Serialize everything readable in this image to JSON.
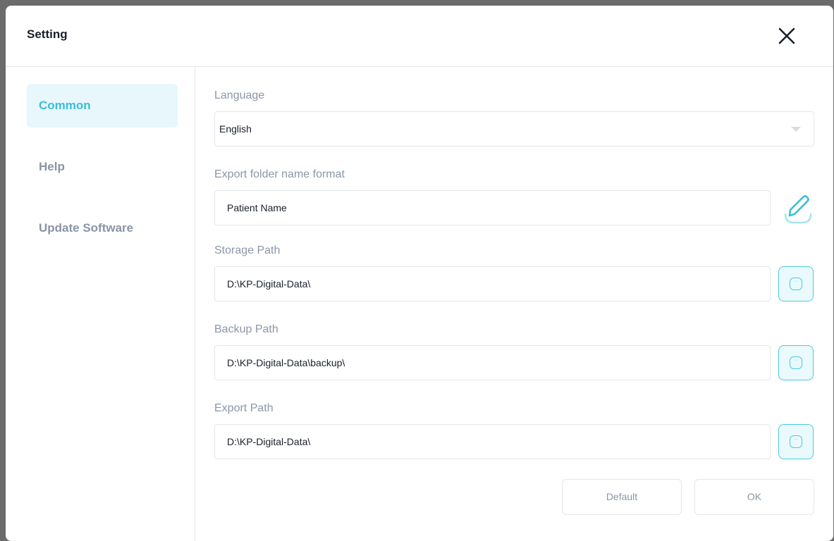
{
  "dialog": {
    "title": "Setting"
  },
  "sidebar": {
    "items": [
      {
        "label": "Common",
        "active": true
      },
      {
        "label": "Help",
        "active": false
      },
      {
        "label": "Update Software",
        "active": false
      }
    ]
  },
  "fields": {
    "language": {
      "label": "Language",
      "value": "English"
    },
    "export_folder_format": {
      "label": "Export folder name format",
      "value": "Patient Name"
    },
    "storage_path": {
      "label": "Storage Path",
      "value": "D:\\KP-Digital-Data\\"
    },
    "backup_path": {
      "label": "Backup Path",
      "value": "D:\\KP-Digital-Data\\backup\\"
    },
    "export_path": {
      "label": "Export Path",
      "value": "D:\\KP-Digital-Data\\"
    }
  },
  "footer": {
    "default_label": "Default",
    "ok_label": "OK"
  },
  "icons": {
    "close": "close-icon",
    "edit": "pencil-edit-icon",
    "browse": "folder-browse-icon",
    "dropdown": "chevron-down-icon"
  },
  "colors": {
    "accent": "#3bbfd6",
    "accent_bg": "#e7f7fb",
    "muted_text": "#8c96a8",
    "border": "#e3e6ea"
  }
}
